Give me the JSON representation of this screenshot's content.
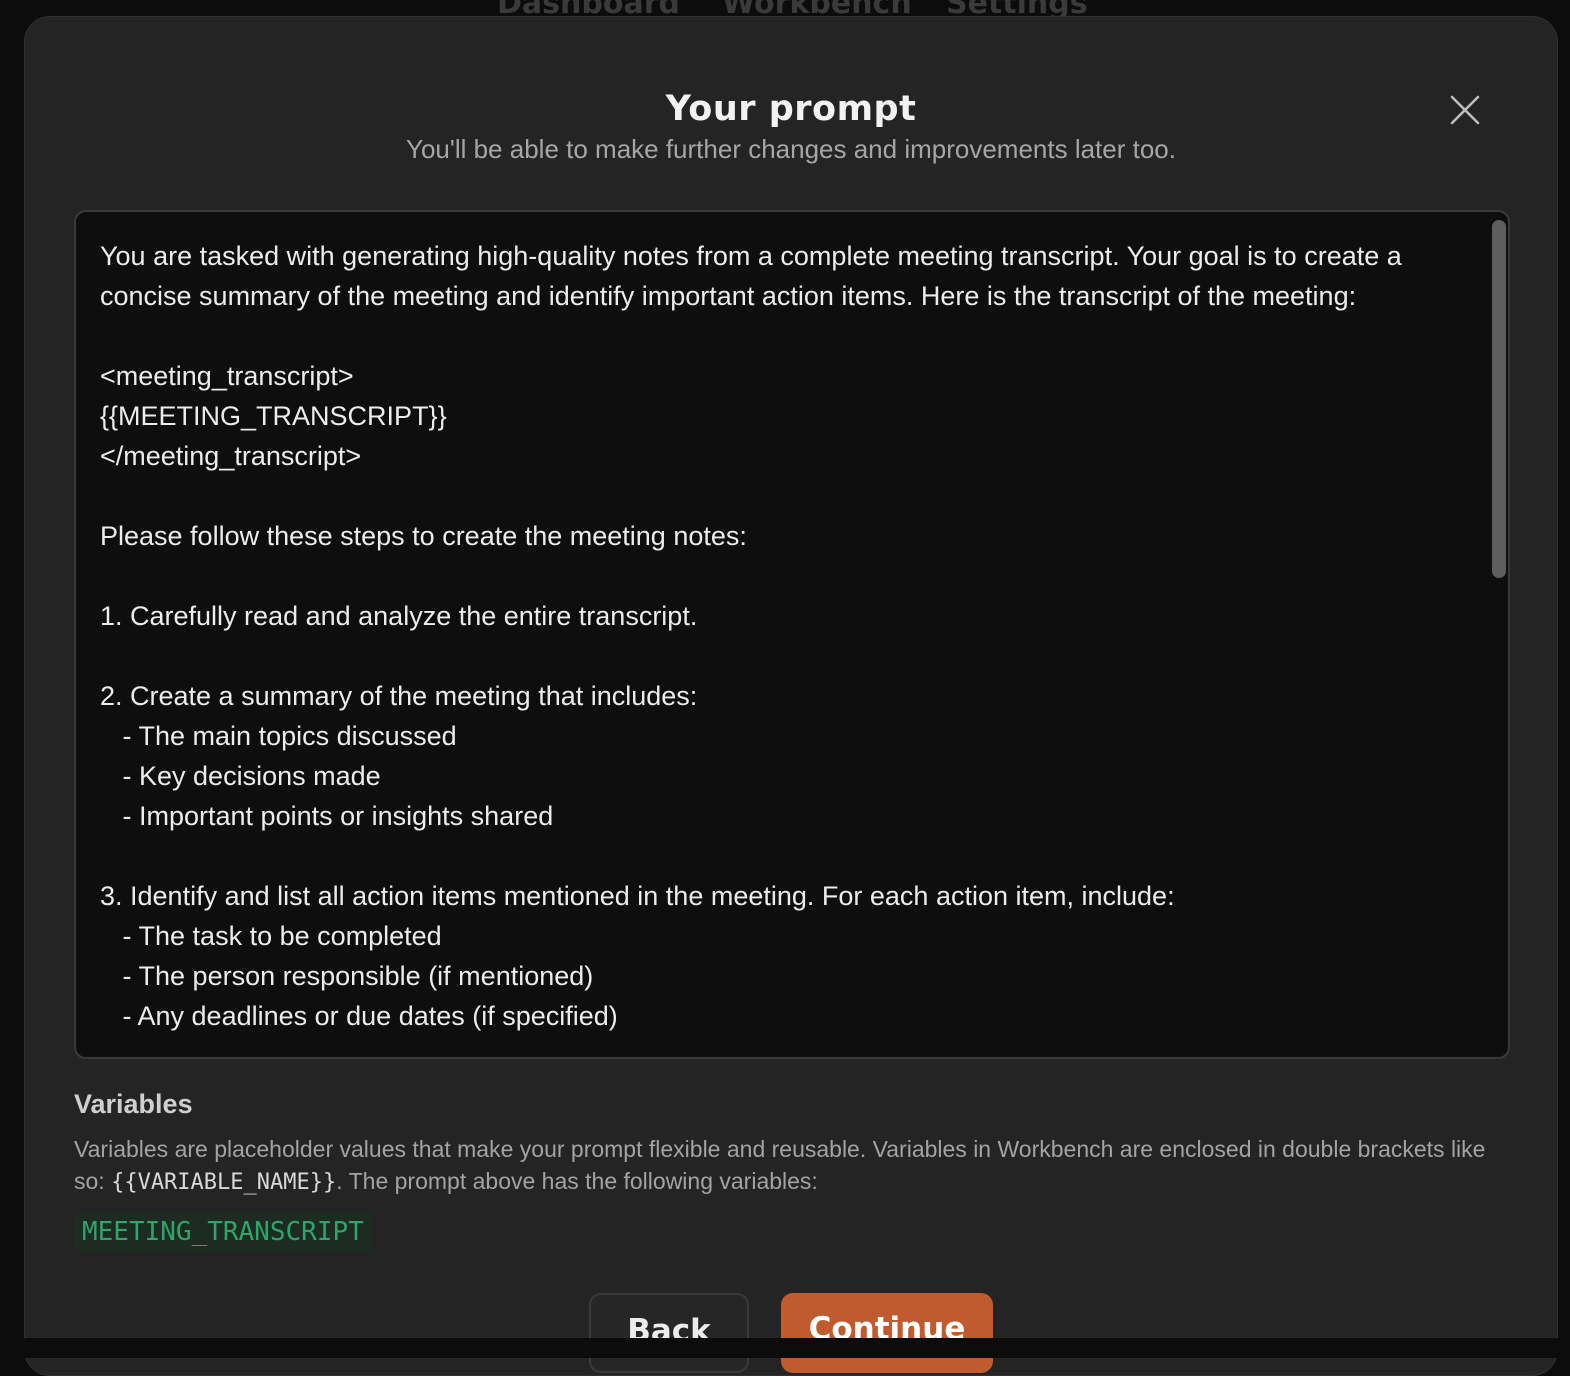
{
  "background_nav": {
    "items": [
      "Dashboard",
      "Workbench",
      "Settings"
    ]
  },
  "modal": {
    "title": "Your prompt",
    "subtitle": "You'll be able to make further changes and improvements later too.",
    "close_icon": "close-icon",
    "prompt_text": "You are tasked with generating high-quality notes from a complete meeting transcript. Your goal is to create a concise summary of the meeting and identify important action items. Here is the transcript of the meeting:\n\n<meeting_transcript>\n{{MEETING_TRANSCRIPT}}\n</meeting_transcript>\n\nPlease follow these steps to create the meeting notes:\n\n1. Carefully read and analyze the entire transcript.\n\n2. Create a summary of the meeting that includes:\n   - The main topics discussed\n   - Key decisions made\n   - Important points or insights shared\n\n3. Identify and list all action items mentioned in the meeting. For each action item, include:\n   - The task to be completed\n   - The person responsible (if mentioned)\n   - Any deadlines or due dates (if specified)"
  },
  "variables": {
    "heading": "Variables",
    "desc_before": "Variables are placeholder values that make your prompt flexible and reusable. Variables in Workbench are enclosed in double brackets like so: ",
    "desc_code": "{{VARIABLE_NAME}}",
    "desc_after": ". The prompt above has the following variables:",
    "items": [
      "MEETING_TRANSCRIPT"
    ]
  },
  "buttons": {
    "back_label": "Back",
    "continue_label": "Continue"
  },
  "colors": {
    "accent": "#bf5b2e",
    "variable_green": "#2fa46b",
    "modal_bg": "#242424",
    "prompt_bg": "#0e0e0e"
  }
}
